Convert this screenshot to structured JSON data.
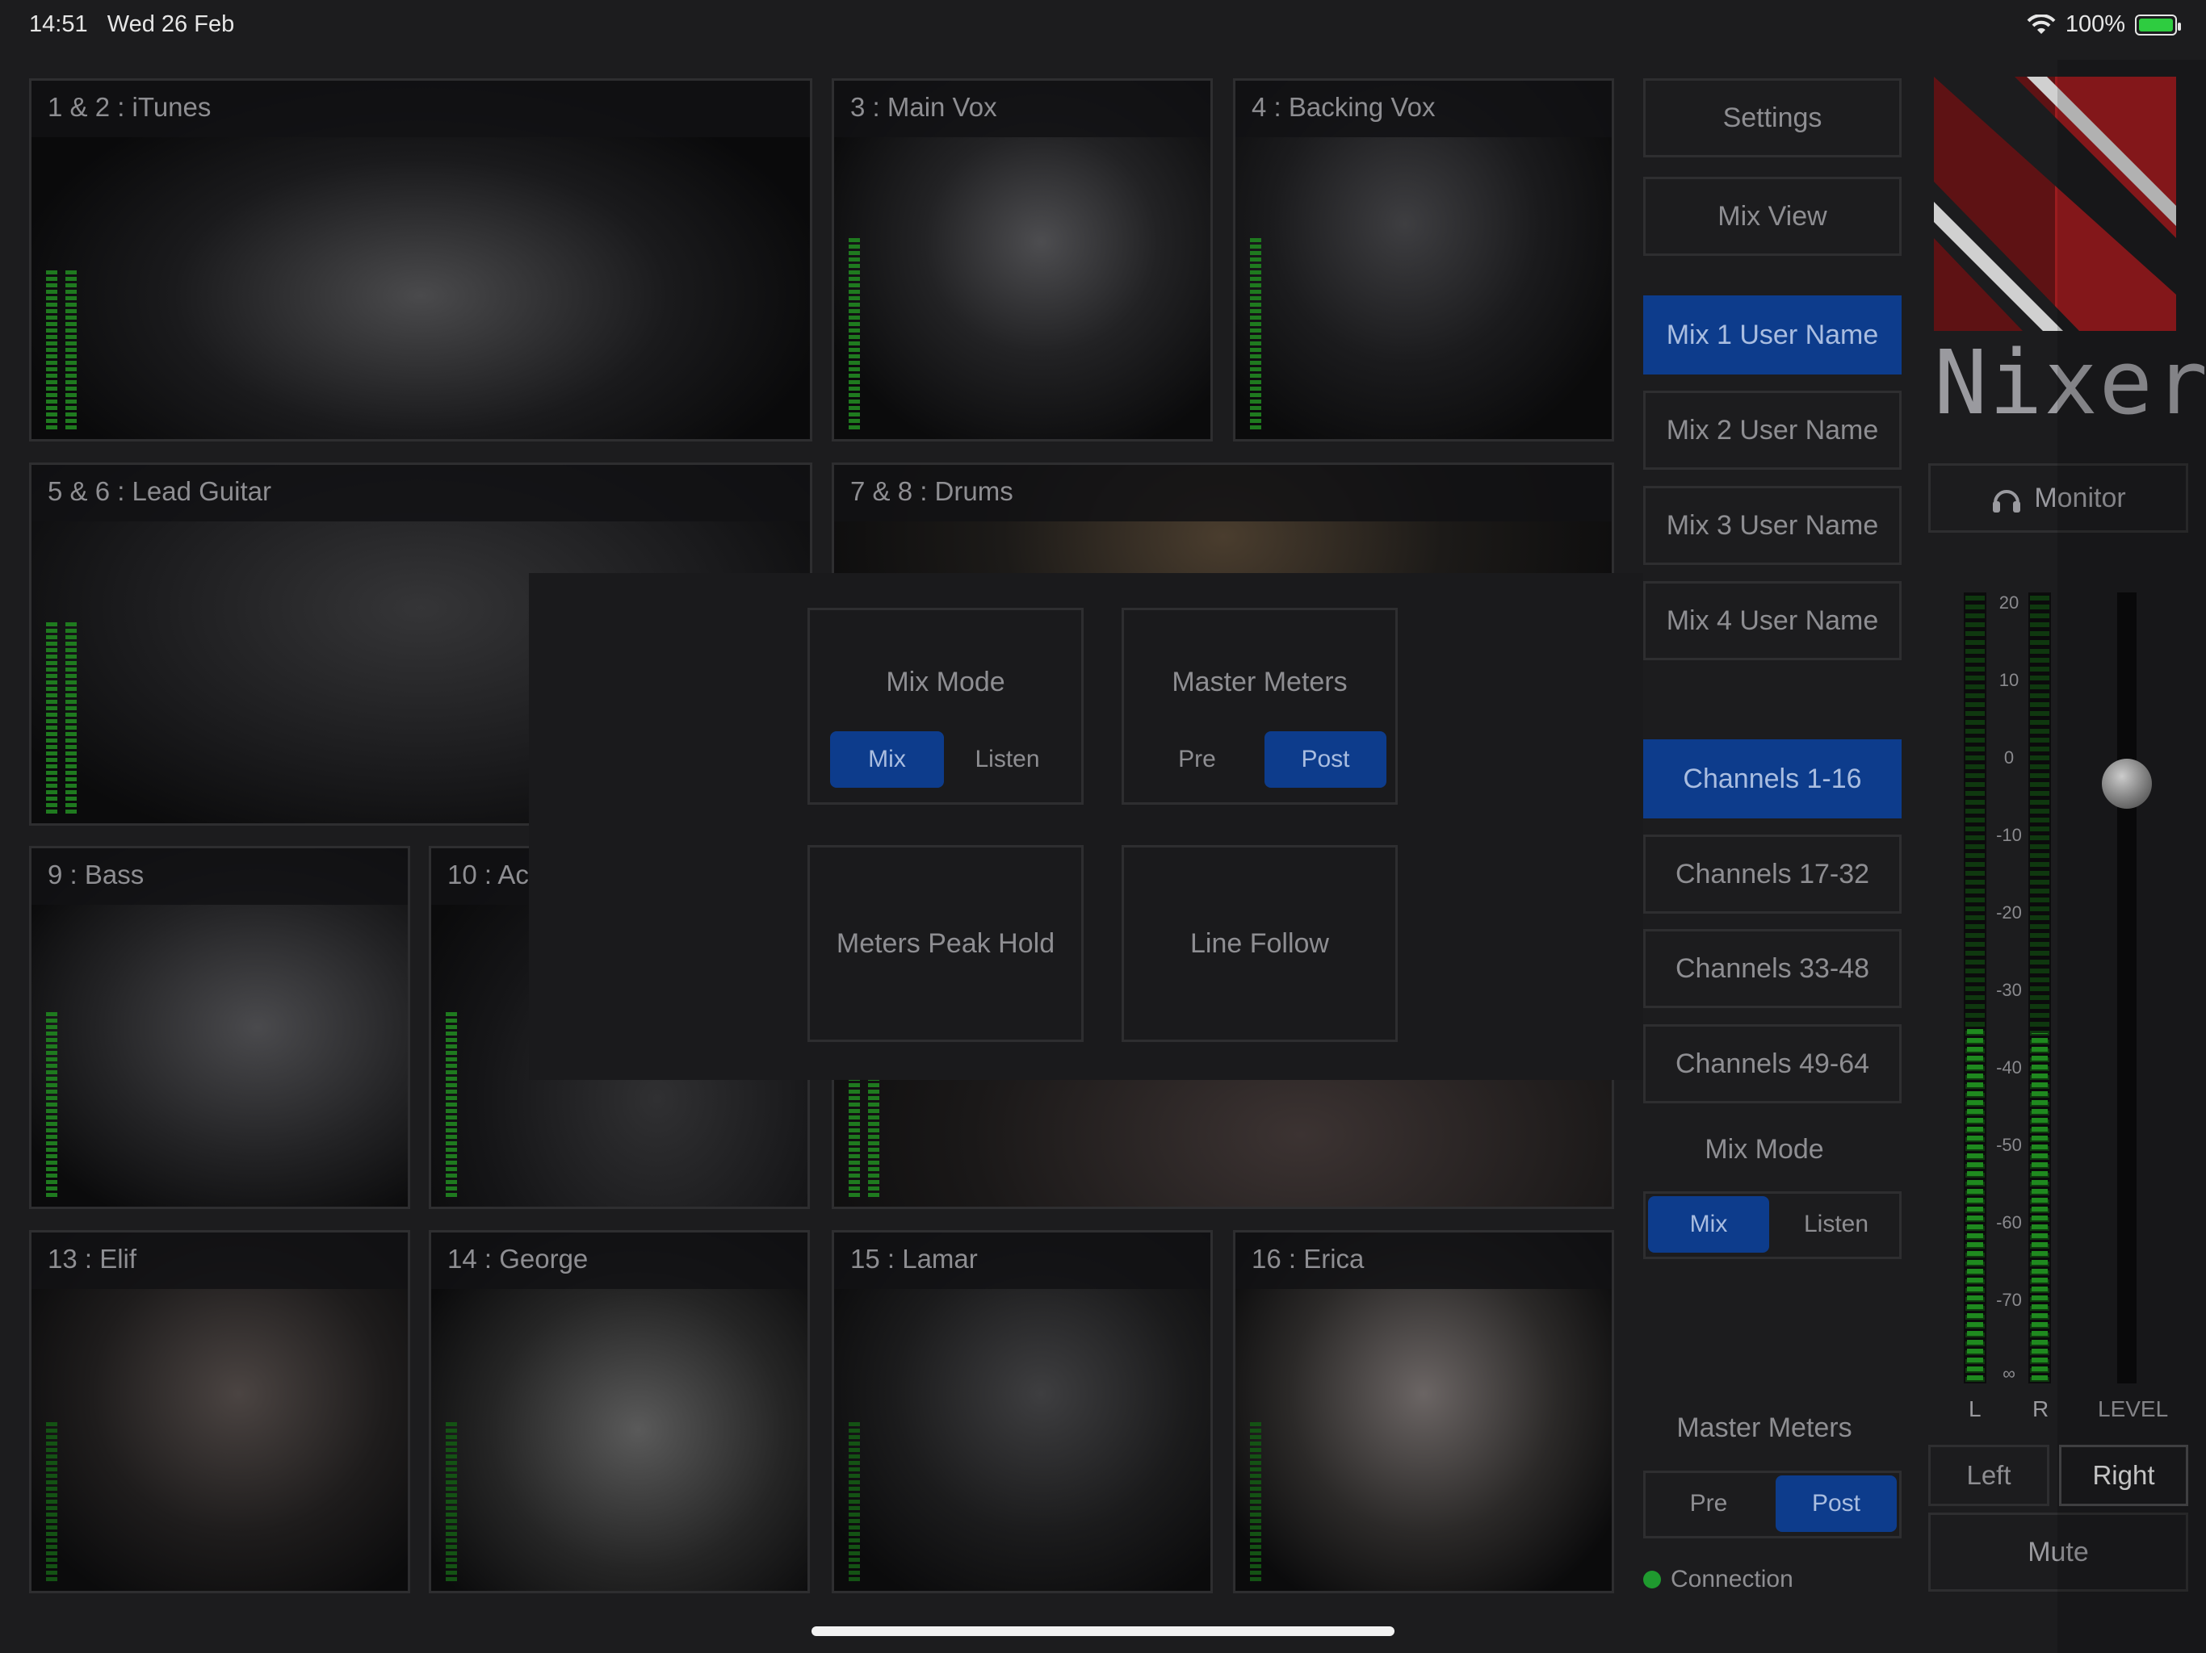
{
  "status_bar": {
    "time": "14:51",
    "date": "Wed 26 Feb",
    "battery": "100%"
  },
  "tiles": [
    {
      "label": "1 & 2 : iTunes"
    },
    {
      "label": "3 : Main Vox"
    },
    {
      "label": "4 : Backing Vox"
    },
    {
      "label": "5 & 6 : Lead Guitar"
    },
    {
      "label": "7 & 8 : Drums"
    },
    {
      "label": "9 : Bass"
    },
    {
      "label": "10 : Ac"
    },
    {
      "label": "13 : Elif"
    },
    {
      "label": "14 : George"
    },
    {
      "label": "15 : Lamar"
    },
    {
      "label": "16 : Erica"
    }
  ],
  "side_buttons": {
    "settings": "Settings",
    "mix_view": "Mix View",
    "mixes": [
      "Mix 1 User Name",
      "Mix 2 User Name",
      "Mix 3 User Name",
      "Mix 4 User Name"
    ],
    "channels": [
      "Channels 1-16",
      "Channels 17-32",
      "Channels 33-48",
      "Channels 49-64"
    ]
  },
  "side_mix_mode": {
    "title": "Mix Mode",
    "options": [
      "Mix",
      "Listen"
    ],
    "selected": "Mix"
  },
  "side_master_meters": {
    "title": "Master Meters",
    "options": [
      "Pre",
      "Post"
    ],
    "selected": "Post"
  },
  "connection": "Connection",
  "overlay": {
    "mix_mode": {
      "title": "Mix Mode",
      "options": [
        "Mix",
        "Listen"
      ],
      "selected": "Mix"
    },
    "master_meters": {
      "title": "Master Meters",
      "options": [
        "Pre",
        "Post"
      ],
      "selected": "Post"
    },
    "meters_peak_hold": "Meters Peak Hold",
    "line_follow": "Line Follow"
  },
  "brand": {
    "name": "Nixer",
    "primary": "#9b1c1f",
    "accent": "#0d3c8c"
  },
  "monitor": {
    "label": "Monitor",
    "icon": "headphones-icon"
  },
  "master_meter": {
    "scale": [
      "20",
      "10",
      "0",
      "-10",
      "-20",
      "-30",
      "-40",
      "-50",
      "-60",
      "-70",
      "∞"
    ],
    "left_label": "L",
    "right_label": "R",
    "level_label": "LEVEL"
  },
  "output": {
    "left": "Left",
    "right": "Right",
    "selected": "Right"
  },
  "mute": "Mute"
}
